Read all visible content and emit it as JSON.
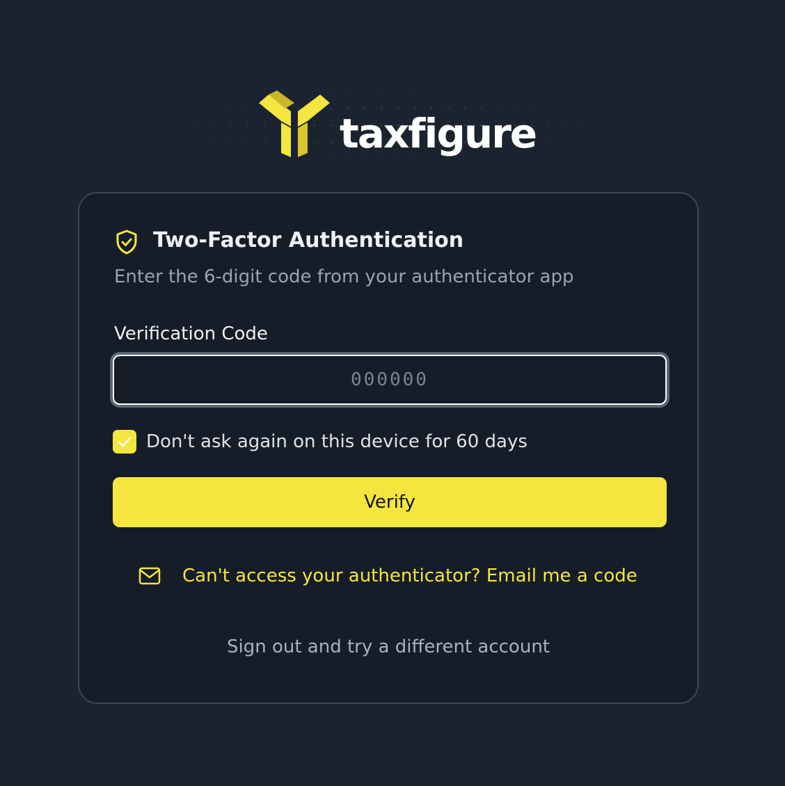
{
  "brand": {
    "name": "taxfigure",
    "accent_color": "#f4e63e",
    "logo_icon": "y-bracket-logo"
  },
  "card": {
    "title": "Two-Factor Authentication",
    "title_icon": "shield-check-icon",
    "subtitle": "Enter the 6-digit code from your authenticator app",
    "code_field": {
      "label": "Verification Code",
      "placeholder": "000000",
      "value": ""
    },
    "remember_device": {
      "label": "Don't ask again on this device for 60 days",
      "checked": true
    },
    "verify_button": {
      "label": "Verify"
    },
    "email_fallback": {
      "icon": "mail-icon",
      "label": "Can't access your authenticator? Email me a code"
    },
    "sign_out": {
      "label": "Sign out and try a different account"
    }
  }
}
